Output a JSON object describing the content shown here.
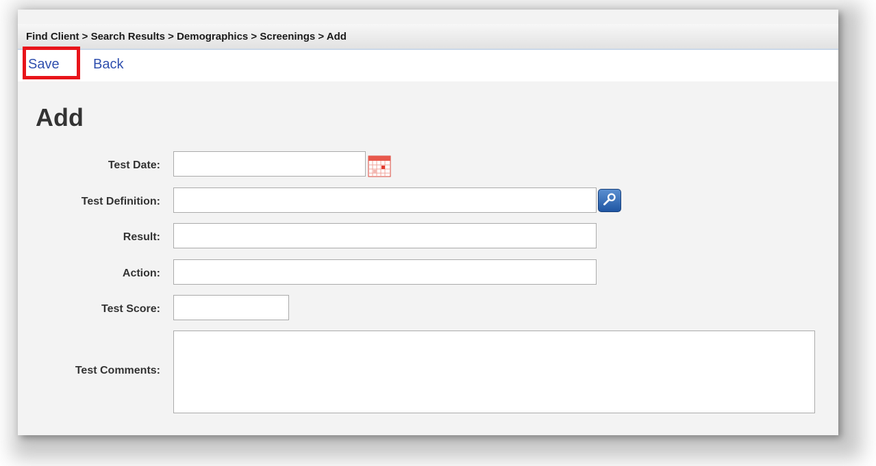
{
  "breadcrumb": "Find Client > Search Results > Demographics > Screenings > Add",
  "toolbar": {
    "save_label": "Save",
    "back_label": "Back"
  },
  "page_title": "Add",
  "form": {
    "test_date_label": "Test Date:",
    "test_date_value": "",
    "test_definition_label": "Test Definition:",
    "test_definition_value": "",
    "result_label": "Result:",
    "result_value": "",
    "action_label": "Action:",
    "action_value": "",
    "test_score_label": "Test Score:",
    "test_score_value": "",
    "test_comments_label": "Test Comments:",
    "test_comments_value": ""
  },
  "icons": {
    "date": "calendar-icon",
    "lookup": "magnifier-lookup-icon"
  },
  "colors": {
    "link": "#2f4fae",
    "highlight": "#e8141a"
  }
}
